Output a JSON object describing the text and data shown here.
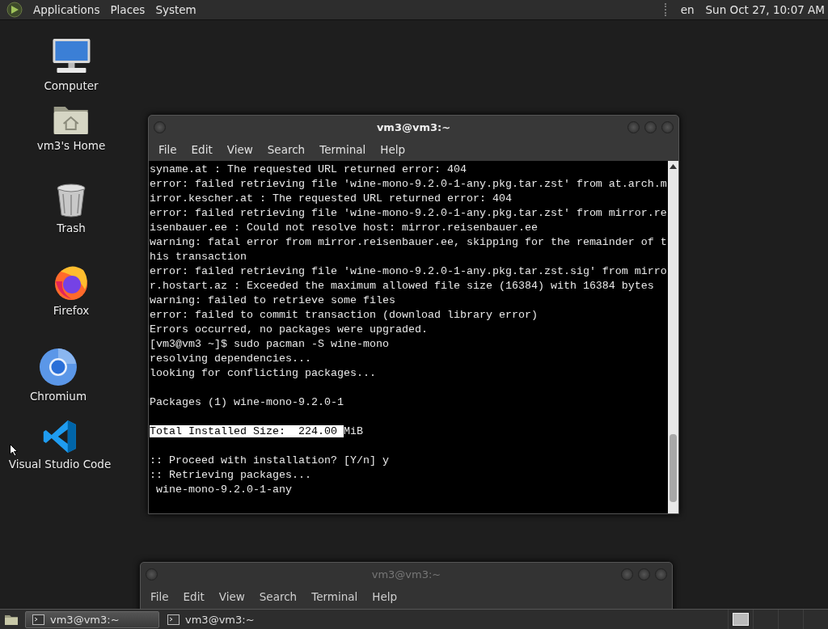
{
  "top_panel": {
    "menus": [
      "Applications",
      "Places",
      "System"
    ],
    "keyboard_layout": "en",
    "clock": "Sun Oct 27, 10:07 AM"
  },
  "desktop_icons": [
    {
      "label": "Computer",
      "kind": "computer"
    },
    {
      "label": "vm3's Home",
      "kind": "home"
    },
    {
      "label": "Trash",
      "kind": "trash"
    },
    {
      "label": "Firefox",
      "kind": "firefox"
    },
    {
      "label": "Chromium",
      "kind": "chromium"
    },
    {
      "label": "Visual Studio Code",
      "kind": "vscode"
    }
  ],
  "windows": [
    {
      "title": "vm3@vm3:~",
      "active": true,
      "menu": [
        "File",
        "Edit",
        "View",
        "Search",
        "Terminal",
        "Help"
      ],
      "lines": [
        {
          "kind": "text",
          "text": "syname.at : The requested URL returned error: 404"
        },
        {
          "kind": "text",
          "text": "error: failed retrieving file 'wine-mono-9.2.0-1-any.pkg.tar.zst' from at.arch.m"
        },
        {
          "kind": "text",
          "text": "irror.kescher.at : The requested URL returned error: 404"
        },
        {
          "kind": "text",
          "text": "error: failed retrieving file 'wine-mono-9.2.0-1-any.pkg.tar.zst' from mirror.re"
        },
        {
          "kind": "text",
          "text": "isenbauer.ee : Could not resolve host: mirror.reisenbauer.ee"
        },
        {
          "kind": "text",
          "text": "warning: fatal error from mirror.reisenbauer.ee, skipping for the remainder of t"
        },
        {
          "kind": "text",
          "text": "his transaction"
        },
        {
          "kind": "text",
          "text": "error: failed retrieving file 'wine-mono-9.2.0-1-any.pkg.tar.zst.sig' from mirro"
        },
        {
          "kind": "text",
          "text": "r.hostart.az : Exceeded the maximum allowed file size (16384) with 16384 bytes"
        },
        {
          "kind": "text",
          "text": "warning: failed to retrieve some files"
        },
        {
          "kind": "text",
          "text": "error: failed to commit transaction (download library error)"
        },
        {
          "kind": "text",
          "text": "Errors occurred, no packages were upgraded."
        },
        {
          "kind": "text",
          "text": "[vm3@vm3 ~]$ sudo pacman -S wine-mono"
        },
        {
          "kind": "text",
          "text": "resolving dependencies..."
        },
        {
          "kind": "text",
          "text": "looking for conflicting packages..."
        },
        {
          "kind": "blank"
        },
        {
          "kind": "text",
          "text": "Packages (1) wine-mono-9.2.0-1"
        },
        {
          "kind": "blank"
        },
        {
          "kind": "text",
          "selected_text": "Total Installed Size:  224.00 ",
          "text": "MiB"
        },
        {
          "kind": "blank"
        },
        {
          "kind": "text",
          "text": ":: Proceed with installation? [Y/n] y"
        },
        {
          "kind": "text",
          "text": ":: Retrieving packages..."
        },
        {
          "kind": "text",
          "text": " wine-mono-9.2.0-1-any"
        }
      ]
    },
    {
      "title": "vm3@vm3:~",
      "active": false,
      "menu": [
        "File",
        "Edit",
        "View",
        "Search",
        "Terminal",
        "Help"
      ]
    }
  ],
  "taskbar": {
    "tasks": [
      {
        "label": "vm3@vm3:~",
        "selected": true
      },
      {
        "label": "vm3@vm3:~",
        "selected": false
      }
    ]
  }
}
